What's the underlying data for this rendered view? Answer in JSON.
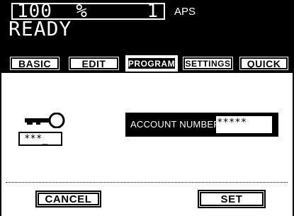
{
  "status": {
    "zoom": "100  %",
    "copies": "1",
    "paper": "APS",
    "message": "READY"
  },
  "tabs": [
    {
      "label": "BASIC"
    },
    {
      "label": "EDIT"
    },
    {
      "label": "PROGRAM",
      "active": true
    },
    {
      "label": "SETTINGS"
    },
    {
      "label": "QUICK"
    }
  ],
  "main": {
    "icon": "key-icon",
    "pin_display": "***_",
    "account_label": "ACCOUNT NUMBER",
    "account_value": "*****"
  },
  "footer": {
    "cancel_label": "CANCEL",
    "set_label": "SET"
  }
}
